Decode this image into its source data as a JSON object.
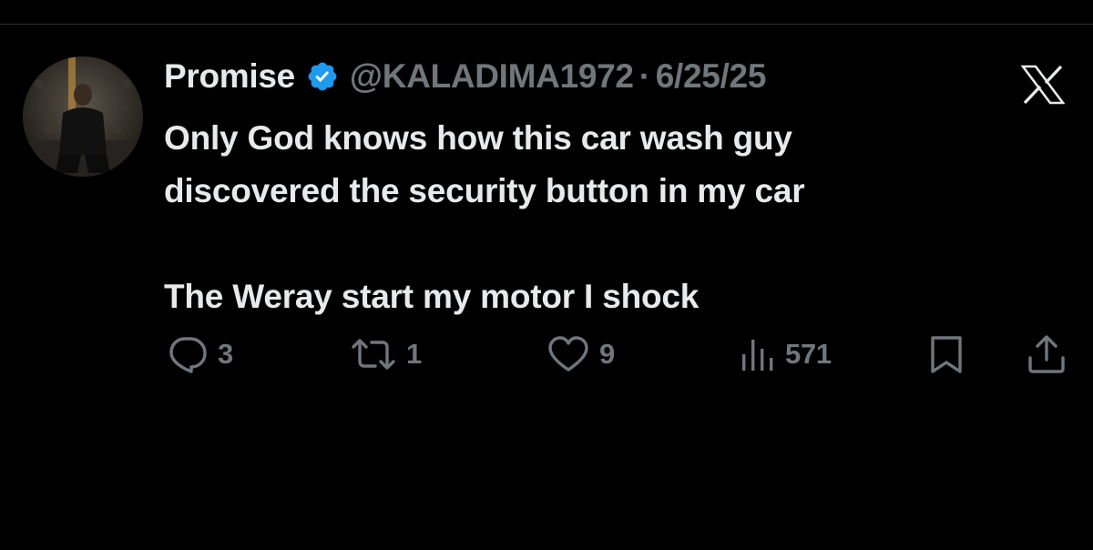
{
  "post": {
    "author": {
      "display_name": "Promise",
      "verified": true,
      "handle": "@KALADIMA1972",
      "avatar_icon": "profile-photo"
    },
    "separator": "·",
    "date": "6/25/25",
    "text_lines": [
      "Only God knows how this car wash guy",
      "discovered the security button in my car",
      "",
      "The Weray start my motor I shock"
    ],
    "actions": {
      "reply": {
        "icon": "reply-icon",
        "count": "3"
      },
      "repost": {
        "icon": "repost-icon",
        "count": "1"
      },
      "like": {
        "icon": "heart-icon",
        "count": "9"
      },
      "views": {
        "icon": "views-icon",
        "count": "571"
      },
      "bookmark": {
        "icon": "bookmark-icon"
      },
      "share": {
        "icon": "share-icon"
      }
    },
    "close_icon": "x-logo-icon"
  },
  "colors": {
    "background": "#000000",
    "primary_text": "#e7e9ea",
    "secondary_text": "#71767b",
    "verified_badge": "#1d9bf0",
    "divider": "#2f3336"
  }
}
